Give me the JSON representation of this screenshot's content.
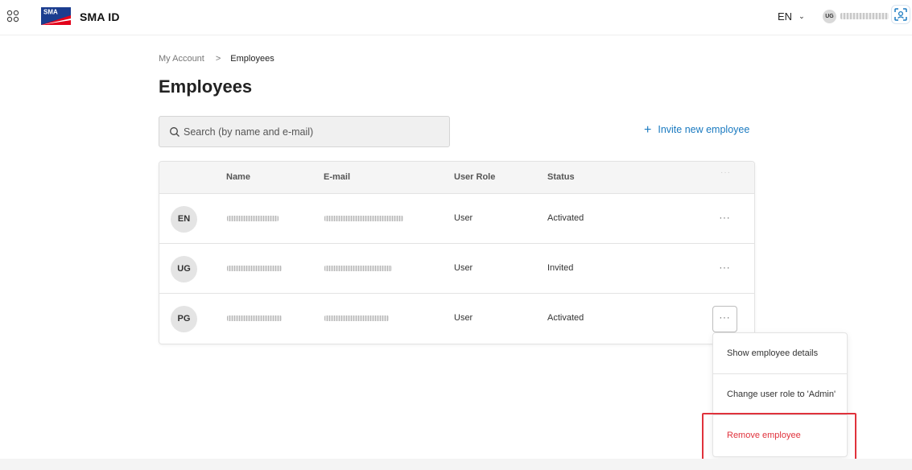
{
  "app": {
    "name": "SMA ID",
    "logo_text": "SMA"
  },
  "header": {
    "language": "EN",
    "user_initials": "UG"
  },
  "breadcrumb": {
    "parent": "My Account",
    "separator": ">",
    "current": "Employees"
  },
  "page": {
    "title": "Employees"
  },
  "search": {
    "placeholder": "Search (by name and e-mail)"
  },
  "invite": {
    "plus": "+",
    "label": "Invite new employee"
  },
  "table": {
    "columns": {
      "name": "Name",
      "email": "E-mail",
      "role": "User Role",
      "status": "Status",
      "actions": "···"
    },
    "rows": [
      {
        "initials": "EN",
        "role": "User",
        "status": "Activated",
        "menu": "···"
      },
      {
        "initials": "UG",
        "role": "User",
        "status": "Invited",
        "menu": "···"
      },
      {
        "initials": "PG",
        "role": "User",
        "status": "Activated",
        "menu": "···"
      }
    ]
  },
  "row_menu": {
    "items": [
      {
        "label": "Show employee details"
      },
      {
        "label": "Change user role to 'Admin'"
      },
      {
        "label": "Remove employee"
      }
    ]
  },
  "colors": {
    "accent": "#1a7ac0",
    "danger": "#e0323c",
    "brand_red": "#e2001a",
    "brand_blue": "#1b3d8f"
  }
}
